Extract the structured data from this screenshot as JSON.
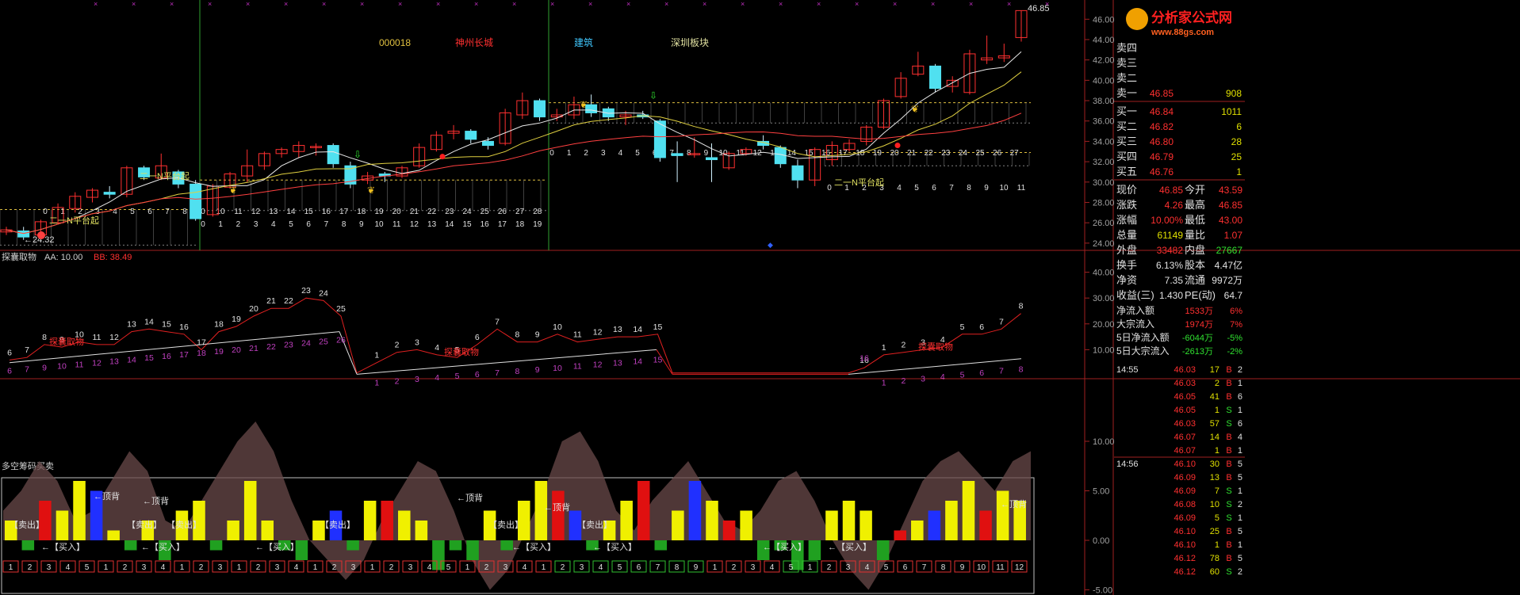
{
  "main_chart": {
    "stock_labels": [
      {
        "text": "000018",
        "color": "#e0c040"
      },
      {
        "text": "神州长城",
        "color": "#ff3030"
      },
      {
        "text": "建筑",
        "color": "#40c8ff"
      },
      {
        "text": "深圳板块",
        "color": "#e0e0a0"
      }
    ],
    "price_axis": [
      "46.00",
      "44.00",
      "42.00",
      "40.00",
      "38.00",
      "36.00",
      "34.00",
      "32.00",
      "30.00",
      "28.00",
      "26.00",
      "24.00"
    ],
    "high_mark": "46.85",
    "low_mark": "24.32",
    "annotations": [
      {
        "text": "二一N平台起"
      },
      {
        "text": "二一N平台起"
      },
      {
        "text": "二一N平台起"
      }
    ],
    "count_rows": {
      "row1": [
        "0",
        "1",
        "2",
        "3",
        "4",
        "5",
        "6",
        "7",
        "8"
      ],
      "row2": [
        "0",
        "10",
        "11",
        "12",
        "13",
        "14",
        "15",
        "16",
        "17",
        "18",
        "19",
        "20",
        "21",
        "22",
        "23",
        "24",
        "25",
        "26",
        "27",
        "28"
      ],
      "row3": [
        "0",
        "1",
        "2",
        "3",
        "4",
        "5",
        "6",
        "7",
        "8",
        "9",
        "10",
        "11",
        "12",
        "13",
        "14",
        "15",
        "16",
        "17",
        "18",
        "19"
      ],
      "row4": [
        "0",
        "1",
        "2",
        "3",
        "4",
        "5",
        "6",
        "7",
        "8",
        "9",
        "10",
        "11",
        "12",
        "13",
        "14",
        "15",
        "16",
        "17",
        "18",
        "19",
        "20",
        "21",
        "22",
        "23",
        "24",
        "25",
        "26",
        "27"
      ],
      "row5": [
        "0",
        "1",
        "2",
        "3",
        "4",
        "5",
        "6",
        "7",
        "8",
        "9",
        "10",
        "11"
      ]
    },
    "candles": [
      {
        "o": 25.1,
        "h": 25.6,
        "l": 24.8,
        "c": 25.3
      },
      {
        "o": 25.2,
        "h": 25.6,
        "l": 24.32,
        "c": 24.6
      },
      {
        "o": 24.8,
        "h": 26.3,
        "l": 24.6,
        "c": 26.1
      },
      {
        "o": 26.0,
        "h": 27.9,
        "l": 25.9,
        "c": 27.5
      },
      {
        "o": 27.4,
        "h": 29.0,
        "l": 27.0,
        "c": 28.6
      },
      {
        "o": 28.5,
        "h": 29.4,
        "l": 28.0,
        "c": 29.2
      },
      {
        "o": 29.0,
        "h": 29.6,
        "l": 28.4,
        "c": 28.8
      },
      {
        "o": 28.8,
        "h": 31.6,
        "l": 28.5,
        "c": 31.4
      },
      {
        "o": 31.4,
        "h": 31.6,
        "l": 30.2,
        "c": 30.5
      },
      {
        "o": 30.4,
        "h": 32.8,
        "l": 30.2,
        "c": 31.6
      },
      {
        "o": 31.0,
        "h": 31.2,
        "l": 29.4,
        "c": 29.8
      },
      {
        "o": 29.8,
        "h": 30.2,
        "l": 26.2,
        "c": 26.4
      },
      {
        "o": 26.8,
        "h": 29.8,
        "l": 26.6,
        "c": 29.6
      },
      {
        "o": 29.5,
        "h": 31.0,
        "l": 29.4,
        "c": 30.8
      },
      {
        "o": 30.6,
        "h": 33.2,
        "l": 30.0,
        "c": 31.6
      },
      {
        "o": 31.6,
        "h": 33.0,
        "l": 31.2,
        "c": 32.8
      },
      {
        "o": 32.8,
        "h": 33.4,
        "l": 32.4,
        "c": 33.2
      },
      {
        "o": 33.0,
        "h": 34.0,
        "l": 32.4,
        "c": 33.6
      },
      {
        "o": 33.5,
        "h": 33.8,
        "l": 32.6,
        "c": 33.5
      },
      {
        "o": 33.6,
        "h": 33.8,
        "l": 31.4,
        "c": 31.8
      },
      {
        "o": 31.6,
        "h": 32.0,
        "l": 29.4,
        "c": 29.8
      },
      {
        "o": 30.2,
        "h": 31.0,
        "l": 29.8,
        "c": 30.6
      },
      {
        "o": 30.8,
        "h": 31.0,
        "l": 30.0,
        "c": 30.6
      },
      {
        "o": 30.6,
        "h": 31.6,
        "l": 30.4,
        "c": 31.4
      },
      {
        "o": 31.6,
        "h": 33.8,
        "l": 31.4,
        "c": 33.4
      },
      {
        "o": 33.2,
        "h": 35.0,
        "l": 33.0,
        "c": 34.6
      },
      {
        "o": 34.8,
        "h": 35.6,
        "l": 34.2,
        "c": 35.0
      },
      {
        "o": 35.0,
        "h": 35.2,
        "l": 33.8,
        "c": 34.2
      },
      {
        "o": 34.0,
        "h": 34.4,
        "l": 33.2,
        "c": 33.6
      },
      {
        "o": 33.8,
        "h": 37.2,
        "l": 33.6,
        "c": 36.8
      },
      {
        "o": 36.6,
        "h": 38.8,
        "l": 36.2,
        "c": 38.0
      },
      {
        "o": 38.0,
        "h": 38.2,
        "l": 36.0,
        "c": 36.4
      },
      {
        "o": 36.4,
        "h": 37.2,
        "l": 36.0,
        "c": 36.6
      },
      {
        "o": 36.6,
        "h": 38.4,
        "l": 36.2,
        "c": 37.6
      },
      {
        "o": 37.6,
        "h": 38.6,
        "l": 36.4,
        "c": 36.8
      },
      {
        "o": 37.2,
        "h": 37.4,
        "l": 36.0,
        "c": 36.4
      },
      {
        "o": 36.4,
        "h": 37.0,
        "l": 35.6,
        "c": 36.6
      },
      {
        "o": 36.6,
        "h": 37.0,
        "l": 36.2,
        "c": 36.4
      },
      {
        "o": 36.0,
        "h": 36.2,
        "l": 32.0,
        "c": 32.4
      },
      {
        "o": 32.8,
        "h": 34.0,
        "l": 30.0,
        "c": 32.6
      },
      {
        "o": 32.8,
        "h": 34.4,
        "l": 32.4,
        "c": 32.8
      },
      {
        "o": 32.4,
        "h": 33.8,
        "l": 30.0,
        "c": 32.2
      },
      {
        "o": 31.4,
        "h": 33.0,
        "l": 31.2,
        "c": 32.8
      },
      {
        "o": 32.8,
        "h": 33.4,
        "l": 32.6,
        "c": 33.2
      },
      {
        "o": 34.0,
        "h": 34.6,
        "l": 33.2,
        "c": 33.6
      },
      {
        "o": 33.4,
        "h": 33.6,
        "l": 31.4,
        "c": 31.8
      },
      {
        "o": 31.6,
        "h": 32.2,
        "l": 29.4,
        "c": 30.2
      },
      {
        "o": 30.2,
        "h": 33.4,
        "l": 29.6,
        "c": 33.2
      },
      {
        "o": 32.2,
        "h": 34.0,
        "l": 31.6,
        "c": 33.6
      },
      {
        "o": 33.2,
        "h": 34.2,
        "l": 33.0,
        "c": 33.8
      },
      {
        "o": 34.0,
        "h": 35.6,
        "l": 33.6,
        "c": 35.4
      },
      {
        "o": 35.4,
        "h": 38.2,
        "l": 35.2,
        "c": 38.0
      },
      {
        "o": 38.4,
        "h": 40.8,
        "l": 38.2,
        "c": 40.2
      },
      {
        "o": 40.6,
        "h": 42.8,
        "l": 40.4,
        "c": 41.4
      },
      {
        "o": 41.4,
        "h": 41.6,
        "l": 38.8,
        "c": 39.2
      },
      {
        "o": 39.4,
        "h": 40.4,
        "l": 38.8,
        "c": 40.0
      },
      {
        "o": 38.8,
        "h": 43.0,
        "l": 38.6,
        "c": 42.6
      },
      {
        "o": 42.0,
        "h": 44.4,
        "l": 41.6,
        "c": 42.2
      },
      {
        "o": 42.2,
        "h": 43.6,
        "l": 41.8,
        "c": 42.4
      },
      {
        "o": 44.2,
        "h": 46.85,
        "l": 43.8,
        "c": 46.85
      }
    ]
  },
  "indicator1": {
    "title": "探囊取物",
    "aa_label": "AA: 10.00",
    "bb_label": "BB: 38.49",
    "axis": [
      "40.00",
      "30.00",
      "20.00",
      "10.00"
    ],
    "tag": "探囊取物",
    "red_labels": [
      "6",
      "7",
      "8",
      "9",
      "10",
      "11",
      "12",
      "13",
      "14",
      "15",
      "16",
      "17",
      "18",
      "19",
      "20",
      "21",
      "22",
      "23",
      "24",
      "25",
      "1",
      "2",
      "3",
      "4",
      "5",
      "6",
      "7",
      "8",
      "9",
      "10",
      "11",
      "12",
      "13",
      "14",
      "15",
      "16",
      "1",
      "2",
      "3",
      "4",
      "5",
      "6",
      "7",
      "8",
      "9"
    ],
    "magenta_labels": [
      "6",
      "7",
      "9",
      "10",
      "11",
      "12",
      "13",
      "14",
      "15",
      "16",
      "17",
      "18",
      "19",
      "20",
      "21",
      "22",
      "23",
      "24",
      "25",
      "26",
      "1",
      "2",
      "3",
      "4",
      "5",
      "6",
      "7",
      "8",
      "9",
      "10",
      "11",
      "12",
      "13",
      "14",
      "15",
      "16",
      "1",
      "2",
      "3",
      "4",
      "5",
      "6",
      "7",
      "8",
      "9"
    ]
  },
  "indicator2": {
    "title": "多空筹码买卖",
    "axis": [
      "10.00",
      "5.00",
      "0.00",
      "-5.00"
    ],
    "sell_label": "【卖出】",
    "buy_label": "←【买入】",
    "top_label": "←顶背",
    "box_numbers": [
      "1",
      "2",
      "3",
      "4",
      "5",
      "1",
      "2",
      "3",
      "4",
      "1",
      "2",
      "3",
      "1",
      "2",
      "3",
      "4",
      "1",
      "2",
      "3",
      "1",
      "2",
      "3",
      "4",
      "5",
      "1",
      "2",
      "3",
      "4",
      "1",
      "2",
      "3",
      "4",
      "5",
      "6",
      "7",
      "8",
      "9",
      "1",
      "2",
      "3",
      "4",
      "5",
      "1",
      "2",
      "3",
      "4",
      "5",
      "6",
      "7",
      "8",
      "9",
      "10",
      "11",
      "12"
    ]
  },
  "side_panel": {
    "logo_text": "分析家公式网",
    "logo_url": "www.88gs.com",
    "sell_rows": [
      {
        "label": "卖四",
        "price": "",
        "vol": ""
      },
      {
        "label": "卖三",
        "price": "",
        "vol": ""
      },
      {
        "label": "卖二",
        "price": "",
        "vol": ""
      },
      {
        "label": "卖一",
        "price": "46.85",
        "vol": "908"
      }
    ],
    "buy_rows": [
      {
        "label": "买一",
        "price": "46.84",
        "vol": "1011"
      },
      {
        "label": "买二",
        "price": "46.82",
        "vol": "6"
      },
      {
        "label": "买三",
        "price": "46.80",
        "vol": "28"
      },
      {
        "label": "买四",
        "price": "46.79",
        "vol": "25"
      },
      {
        "label": "买五",
        "price": "46.76",
        "vol": "1"
      }
    ],
    "stats": [
      {
        "l1": "现价",
        "v1": "46.85",
        "c1": "#ff3030",
        "l2": "今开",
        "v2": "43.59",
        "c2": "#ff3030"
      },
      {
        "l1": "涨跌",
        "v1": "4.26",
        "c1": "#ff3030",
        "l2": "最高",
        "v2": "46.85",
        "c2": "#ff3030"
      },
      {
        "l1": "涨幅",
        "v1": "10.00%",
        "c1": "#ff3030",
        "l2": "最低",
        "v2": "43.00",
        "c2": "#ff3030"
      },
      {
        "l1": "总量",
        "v1": "61149",
        "c1": "#e0e000",
        "l2": "量比",
        "v2": "1.07",
        "c2": "#ff3030"
      },
      {
        "l1": "外盘",
        "v1": "33482",
        "c1": "#ff3030",
        "l2": "内盘",
        "v2": "27667",
        "c2": "#30e030"
      },
      {
        "l1": "换手",
        "v1": "6.13%",
        "c1": "#e0e0e0",
        "l2": "股本",
        "v2": "4.47亿",
        "c2": "#e0e0e0"
      },
      {
        "l1": "净资",
        "v1": "7.35",
        "c1": "#e0e0e0",
        "l2": "流通",
        "v2": "9972万",
        "c2": "#e0e0e0"
      },
      {
        "l1": "收益(三)",
        "v1": "1.430",
        "c1": "#e0e0e0",
        "l2": "PE(动)",
        "v2": "64.7",
        "c2": "#e0e0e0"
      }
    ],
    "flows": [
      {
        "label": "净流入额",
        "value": "1533万",
        "pct": "6%",
        "color": "#ff3030"
      },
      {
        "label": "大宗流入",
        "value": "1974万",
        "pct": "7%",
        "color": "#ff3030"
      },
      {
        "label": "5日净流入额",
        "value": "-6044万",
        "pct": "-5%",
        "color": "#30e030"
      },
      {
        "label": "5日大宗流入",
        "value": "-2613万",
        "pct": "-2%",
        "color": "#30e030"
      }
    ],
    "ticks": [
      {
        "time": "14:55",
        "price": "46.03",
        "vol": "17",
        "bs": "B",
        "n": "2"
      },
      {
        "time": "",
        "price": "46.03",
        "vol": "2",
        "bs": "B",
        "n": "1"
      },
      {
        "time": "",
        "price": "46.05",
        "vol": "41",
        "bs": "B",
        "n": "6"
      },
      {
        "time": "",
        "price": "46.05",
        "vol": "1",
        "bs": "S",
        "n": "1"
      },
      {
        "time": "",
        "price": "46.03",
        "vol": "57",
        "bs": "S",
        "n": "6"
      },
      {
        "time": "",
        "price": "46.07",
        "vol": "14",
        "bs": "B",
        "n": "4"
      },
      {
        "time": "",
        "price": "46.07",
        "vol": "1",
        "bs": "B",
        "n": "1"
      },
      {
        "time": "14:56",
        "price": "46.10",
        "vol": "30",
        "bs": "B",
        "n": "5"
      },
      {
        "time": "",
        "price": "46.09",
        "vol": "13",
        "bs": "B",
        "n": "5"
      },
      {
        "time": "",
        "price": "46.09",
        "vol": "7",
        "bs": "S",
        "n": "1"
      },
      {
        "time": "",
        "price": "46.08",
        "vol": "10",
        "bs": "S",
        "n": "2"
      },
      {
        "time": "",
        "price": "46.09",
        "vol": "5",
        "bs": "S",
        "n": "1"
      },
      {
        "time": "",
        "price": "46.10",
        "vol": "25",
        "bs": "B",
        "n": "5"
      },
      {
        "time": "",
        "price": "46.10",
        "vol": "1",
        "bs": "B",
        "n": "1"
      },
      {
        "time": "",
        "price": "46.12",
        "vol": "78",
        "bs": "B",
        "n": "5"
      },
      {
        "time": "",
        "price": "46.12",
        "vol": "60",
        "bs": "S",
        "n": "2"
      }
    ]
  }
}
